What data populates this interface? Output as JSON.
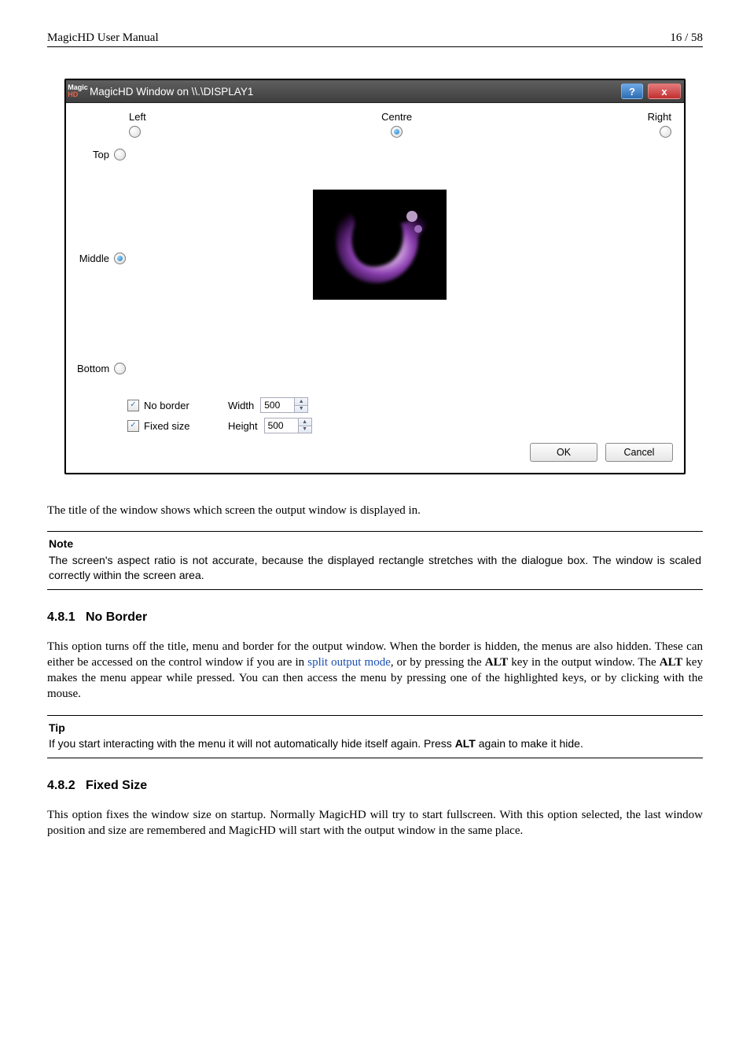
{
  "header": {
    "left": "MagicHD User Manual",
    "right": "16 / 58"
  },
  "dialog": {
    "title": "MagicHD Window on \\\\.\\DISPLAY1",
    "icon_top": "Magic",
    "icon_bottom": "HD",
    "help_glyph": "?",
    "close_glyph": "x",
    "columns": {
      "left": "Left",
      "centre": "Centre",
      "right": "Right"
    },
    "rows": {
      "top": "Top",
      "middle": "Middle",
      "bottom": "Bottom"
    },
    "selected_col": "centre",
    "selected_row": "middle",
    "options": {
      "no_border": {
        "label": "No border",
        "checked": true
      },
      "fixed_size": {
        "label": "Fixed size",
        "checked": true
      }
    },
    "width_label": "Width",
    "width_value": "500",
    "height_label": "Height",
    "height_value": "500",
    "ok": "OK",
    "cancel": "Cancel"
  },
  "doc": {
    "p_after_dialog": "The title of the window shows which screen the output window is displayed in.",
    "note_head": "Note",
    "note_body": "The screen's aspect ratio is not accurate, because the displayed rectangle stretches with the dialogue box. The window is scaled correctly within the screen area.",
    "sec1_num": "4.8.1",
    "sec1_title": "No Border",
    "sec1_p_a": "This option turns off the title, menu and border for the output window. When the border is hidden, the menus are also hidden. These can either be accessed on the control window if you are in ",
    "sec1_link": "split output mode",
    "sec1_p_b": ", or by pressing the ",
    "sec1_alt1": "ALT",
    "sec1_p_c": " key in the output window. The ",
    "sec1_alt2": "ALT",
    "sec1_p_d": " key makes the menu appear while pressed. You can then access the menu by pressing one of the highlighted keys, or by clicking with the mouse.",
    "tip_head": "Tip",
    "tip_body_a": "If you start interacting with the menu it will not automatically hide itself again. Press ",
    "tip_alt": "ALT",
    "tip_body_b": " again to make it hide.",
    "sec2_num": "4.8.2",
    "sec2_title": "Fixed Size",
    "sec2_p": "This option fixes the window size on startup. Normally MagicHD will try to start fullscreen. With this option selected, the last window position and size are remembered and MagicHD will start with the output window in the same place."
  }
}
